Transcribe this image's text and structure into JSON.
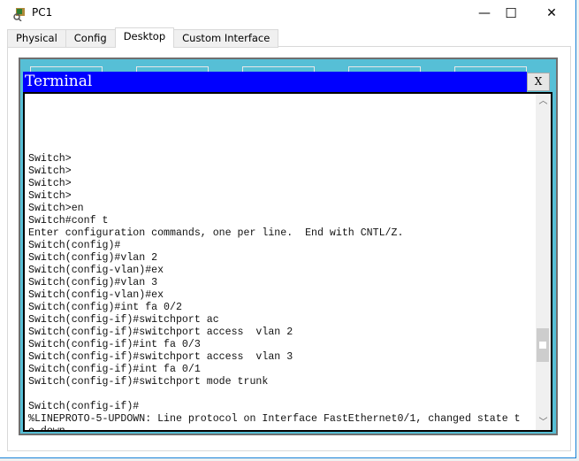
{
  "window": {
    "title": "PC1",
    "minimize": "—",
    "maximize": "☐",
    "close": "✕"
  },
  "tabs": [
    {
      "label": "Physical"
    },
    {
      "label": "Config"
    },
    {
      "label": "Desktop",
      "active": true
    },
    {
      "label": "Custom Interface"
    }
  ],
  "terminal": {
    "title": "Terminal",
    "close_label": "X",
    "lines": [
      "Switch>",
      "Switch>",
      "Switch>",
      "Switch>",
      "Switch>en",
      "Switch#conf t",
      "Enter configuration commands, one per line.  End with CNTL/Z.",
      "Switch(config)#",
      "Switch(config)#vlan 2",
      "Switch(config-vlan)#ex",
      "Switch(config)#vlan 3",
      "Switch(config-vlan)#ex",
      "Switch(config)#int fa 0/2",
      "Switch(config-if)#switchport ac",
      "Switch(config-if)#switchport access  vlan 2",
      "Switch(config-if)#int fa 0/3",
      "Switch(config-if)#switchport access  vlan 3",
      "Switch(config-if)#int fa 0/1",
      "Switch(config-if)#switchport mode trunk",
      "",
      "Switch(config-if)#",
      "%LINEPROTO-5-UPDOWN: Line protocol on Interface FastEthernet0/1, changed state t",
      "o down"
    ],
    "scroll_position": 0.9
  }
}
